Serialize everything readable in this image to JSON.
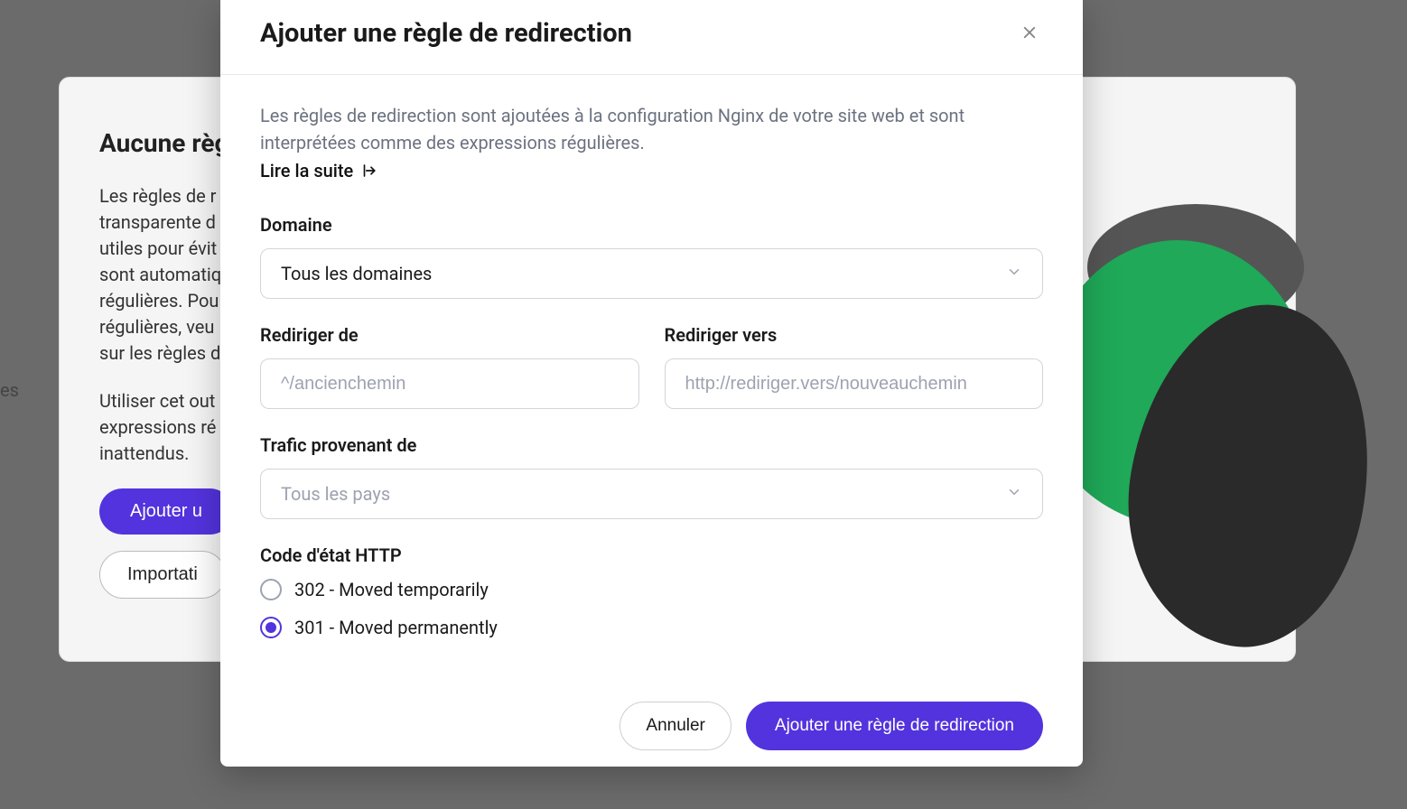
{
  "background": {
    "sidebar_fragment": "es",
    "card_title": "Aucune règl",
    "card_p1": "Les règles de r\ntransparente d\nutiles pour évit\nsont automatiq\nrégulières. Pou\nrégulières, veu\nsur les règles d",
    "card_p2": "Utiliser cet out\nexpressions ré\ninattendus.",
    "primary_btn": "Ajouter u",
    "secondary_btn": "Importati"
  },
  "modal": {
    "title": "Ajouter une règle de redirection",
    "intro": "Les règles de redirection sont ajoutées à la configuration Nginx de votre site web et sont interprétées comme des expressions régulières.",
    "read_more": "Lire la suite",
    "fields": {
      "domain": {
        "label": "Domaine",
        "value": "Tous les domaines"
      },
      "redirect_from": {
        "label": "Rediriger de",
        "placeholder": "^/ancienchemin"
      },
      "redirect_to": {
        "label": "Rediriger vers",
        "placeholder": "http://rediriger.vers/nouveauchemin"
      },
      "traffic_from": {
        "label": "Trafic provenant de",
        "placeholder": "Tous les pays"
      },
      "status_code": {
        "label": "Code d'état HTTP",
        "options": {
          "302": "302 - Moved temporarily",
          "301": "301 - Moved permanently"
        },
        "selected": "301"
      }
    },
    "footer": {
      "cancel": "Annuler",
      "submit": "Ajouter une règle de redirection"
    }
  }
}
